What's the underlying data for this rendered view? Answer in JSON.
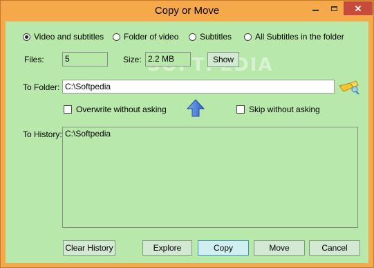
{
  "window": {
    "title": "Copy or Move"
  },
  "options": {
    "radios": [
      {
        "label": "Video and subtitles",
        "selected": true
      },
      {
        "label": "Folder of video",
        "selected": false
      },
      {
        "label": "Subtitles",
        "selected": false
      },
      {
        "label": "All Subtitles in the folder",
        "selected": false
      }
    ]
  },
  "info": {
    "files_label": "Files:",
    "files_value": "5",
    "size_label": "Size:",
    "size_value": "2.2 MB",
    "show_label": "Show"
  },
  "folder": {
    "label": "To Folder:",
    "value": "C:\\Softpedia",
    "overwrite_label": "Overwrite without asking",
    "overwrite_checked": false,
    "skip_label": "Skip without asking",
    "skip_checked": false
  },
  "history": {
    "label": "To History:",
    "items": [
      "C:\\Softpedia"
    ]
  },
  "buttons": {
    "clear_history": "Clear History",
    "explore": "Explore",
    "copy": "Copy",
    "move": "Move",
    "cancel": "Cancel"
  },
  "watermark": "SOFTPEDIA",
  "colors": {
    "frame": "#f5a94a",
    "client": "#b9e8ab",
    "close": "#c74b3c",
    "accent_blue": "#3d8fbf"
  }
}
